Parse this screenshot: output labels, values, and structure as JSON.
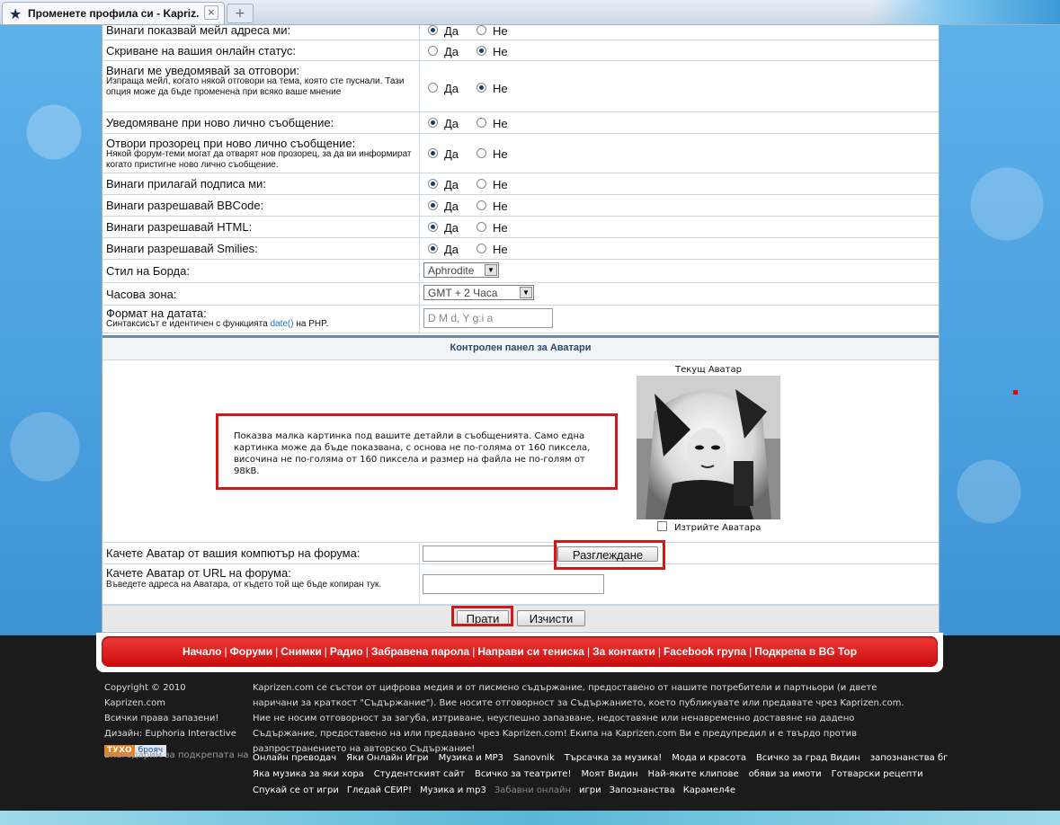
{
  "browser": {
    "tab_title": "Променете профила си - Kapriz...",
    "new_tab_symbol": "+"
  },
  "prefs": [
    {
      "label": "Винаги показвай мейл адреса ми:",
      "yes": "Да",
      "no": "Не",
      "value": "yes"
    },
    {
      "label": "Скриване на вашия онлайн статус:",
      "yes": "Да",
      "no": "Не",
      "value": "no"
    },
    {
      "label": "Винаги ме уведомявай за отговори:",
      "sub": "Изпраща мейл, когато някой отговори на тема, която сте пуснали. Тази опция може да бъде променена при всяко ваше мнение",
      "yes": "Да",
      "no": "Не",
      "value": "no"
    },
    {
      "label": "Уведомяване при ново лично съобщение:",
      "yes": "Да",
      "no": "Не",
      "value": "yes"
    },
    {
      "label": "Отвори прозорец при ново лично съобщение:",
      "sub": "Някой форум-теми могат да отварят нов прозорец, за да ви информират когато пристигне ново лично съобщение.",
      "yes": "Да",
      "no": "Не",
      "value": "yes"
    },
    {
      "label": "Винаги прилагай подписа ми:",
      "yes": "Да",
      "no": "Не",
      "value": "yes"
    },
    {
      "label": "Винаги разрешавай BBCode:",
      "yes": "Да",
      "no": "Не",
      "value": "yes"
    },
    {
      "label": "Винаги разрешавай HTML:",
      "yes": "Да",
      "no": "Не",
      "value": "yes"
    },
    {
      "label": "Винаги разрешавай Smilies:",
      "yes": "Да",
      "no": "Не",
      "value": "yes"
    }
  ],
  "board_style": {
    "label": "Стил на Борда:",
    "value": "Aphrodite"
  },
  "timezone": {
    "label": "Часова зона:",
    "value": "GMT + 2 Часа"
  },
  "date_format": {
    "label": "Формат на датата:",
    "sub_before": "Синтаксисът е идентичен с функцията ",
    "sub_link": "date()",
    "sub_after": " на PHP.",
    "value": "D M d, Y g:i a"
  },
  "avatar": {
    "section_title": "Контролен панел за Аватари",
    "description": "Показва малка картинка под вашите детайли в съобщенията. Само една картинка може да бъде показвана, с основа не по-голяма от 160 пиксела, височина не по-голяма от 160 пиксела и размер на файла не по-голям от 98kB.",
    "current_label": "Текущ Аватар",
    "delete_label": "Изтрийте Аватара",
    "upload_label": "Качете Аватар от вашия компютър на форума:",
    "browse_button": "Разглеждане",
    "url_label": "Качете Аватар от URL на форума:",
    "url_sub": "Въведете адреса на Аватара, от където той ще бъде копиран тук."
  },
  "buttons": {
    "submit": "Прати",
    "reset": "Изчисти"
  },
  "nav": [
    "Начало",
    "Форуми",
    "Снимки",
    "Радио",
    "Забравена парола",
    "Направи си тениска",
    "За контакти",
    "Facebook група",
    "Подкрепа в BG Top"
  ],
  "footer": {
    "copyright": "Copyright © 2010 Kaprizen.com",
    "rights": "Всички права запазени!",
    "design": "Дизайн: Euphoria Interactive",
    "counter_left": "ТУХО",
    "counter_right": "брояч",
    "legal": "Kaprizen.com се състои от цифрова медия и от писмено съдържание, предоставено от нашите потребители и партньори (и двете наричани за краткост \"Съдържание\"). Вие носите отговорност за Съдържанието, което публикувате или предавате чрез Kaprizen.com. Ние не носим отговорност за загуба, изтриване, неуспешно запазване, недоставяне или ненавременно доставяне на дадено Съдържание, предоставено на или предавано чрез Kaprizen.com! Екипа на Kaprizen.com Ви е предупредил и е твърдо против разпространението на авторско Съдържание!",
    "thanks": "Благодарим за подкрепата на",
    "links_row1": [
      "Онлайн преводач",
      "Яки Онлайн Игри",
      "Музика и MP3",
      "Sanovnik",
      "Търсачка за музика!",
      "Мода и красота",
      "Всичко за град Видин",
      "запознанства бг"
    ],
    "links_row2": [
      "Яка музика за яки хора",
      "Студентският сайт",
      "Всичко за театрите!",
      "Моят Видин",
      "Най-яките клипове",
      "обяви за имоти",
      "Готварски рецепти"
    ],
    "links_row3": [
      "Спукай се от игри",
      "Гледай СЕИР!",
      "Музика и mp3",
      "Забавни онлайн",
      "игри",
      "Запознанства",
      "Карамел4е"
    ]
  }
}
